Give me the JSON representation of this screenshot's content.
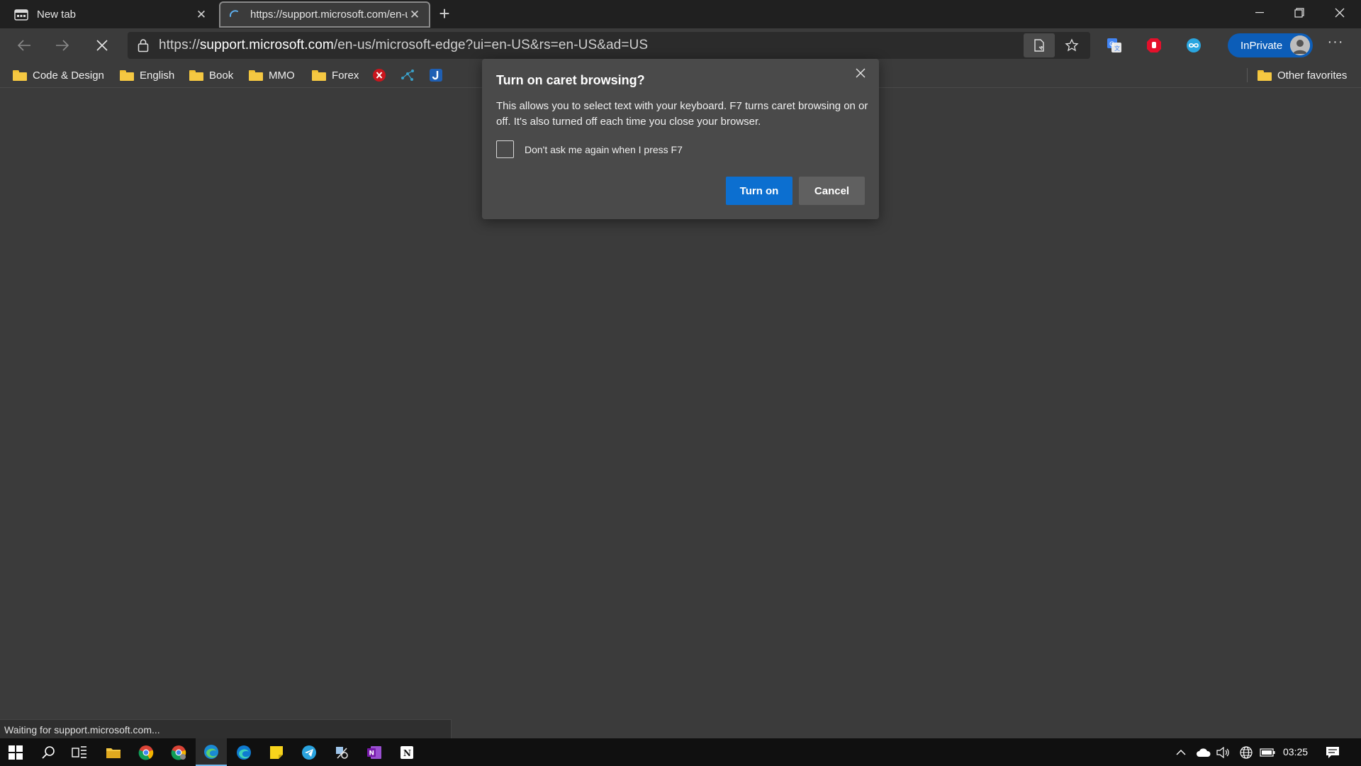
{
  "tabs": [
    {
      "title": "New tab",
      "icon": "newtab-icon"
    },
    {
      "title": "https://support.microsoft.com/en-us/microsoft-edge",
      "icon": "loading-spinner-icon",
      "active": true
    }
  ],
  "address": {
    "scheme": "https://",
    "host": "support.microsoft.com",
    "path": "/en-us/microsoft-edge?ui=en-US&rs=en-US&ad=US"
  },
  "profile": {
    "label": "InPrivate"
  },
  "favorites": [
    {
      "label": "Code & Design"
    },
    {
      "label": "English"
    },
    {
      "label": "Book"
    },
    {
      "label": "MMO"
    },
    {
      "label": "Forex"
    }
  ],
  "other_favorites": "Other favorites",
  "dialog": {
    "title": "Turn on caret browsing?",
    "message": "This allows you to select text with your keyboard. F7 turns caret browsing on or off. It's also turned off each time you close your browser.",
    "checkbox_label": "Don't ask me again when I press F7",
    "primary": "Turn on",
    "secondary": "Cancel"
  },
  "status": "Waiting for support.microsoft.com...",
  "clock": "03:25",
  "colors": {
    "accent": "#0c6fd0",
    "inprivate": "#0c5db8",
    "folder": "#f5c842",
    "background": "#3b3b3b"
  }
}
